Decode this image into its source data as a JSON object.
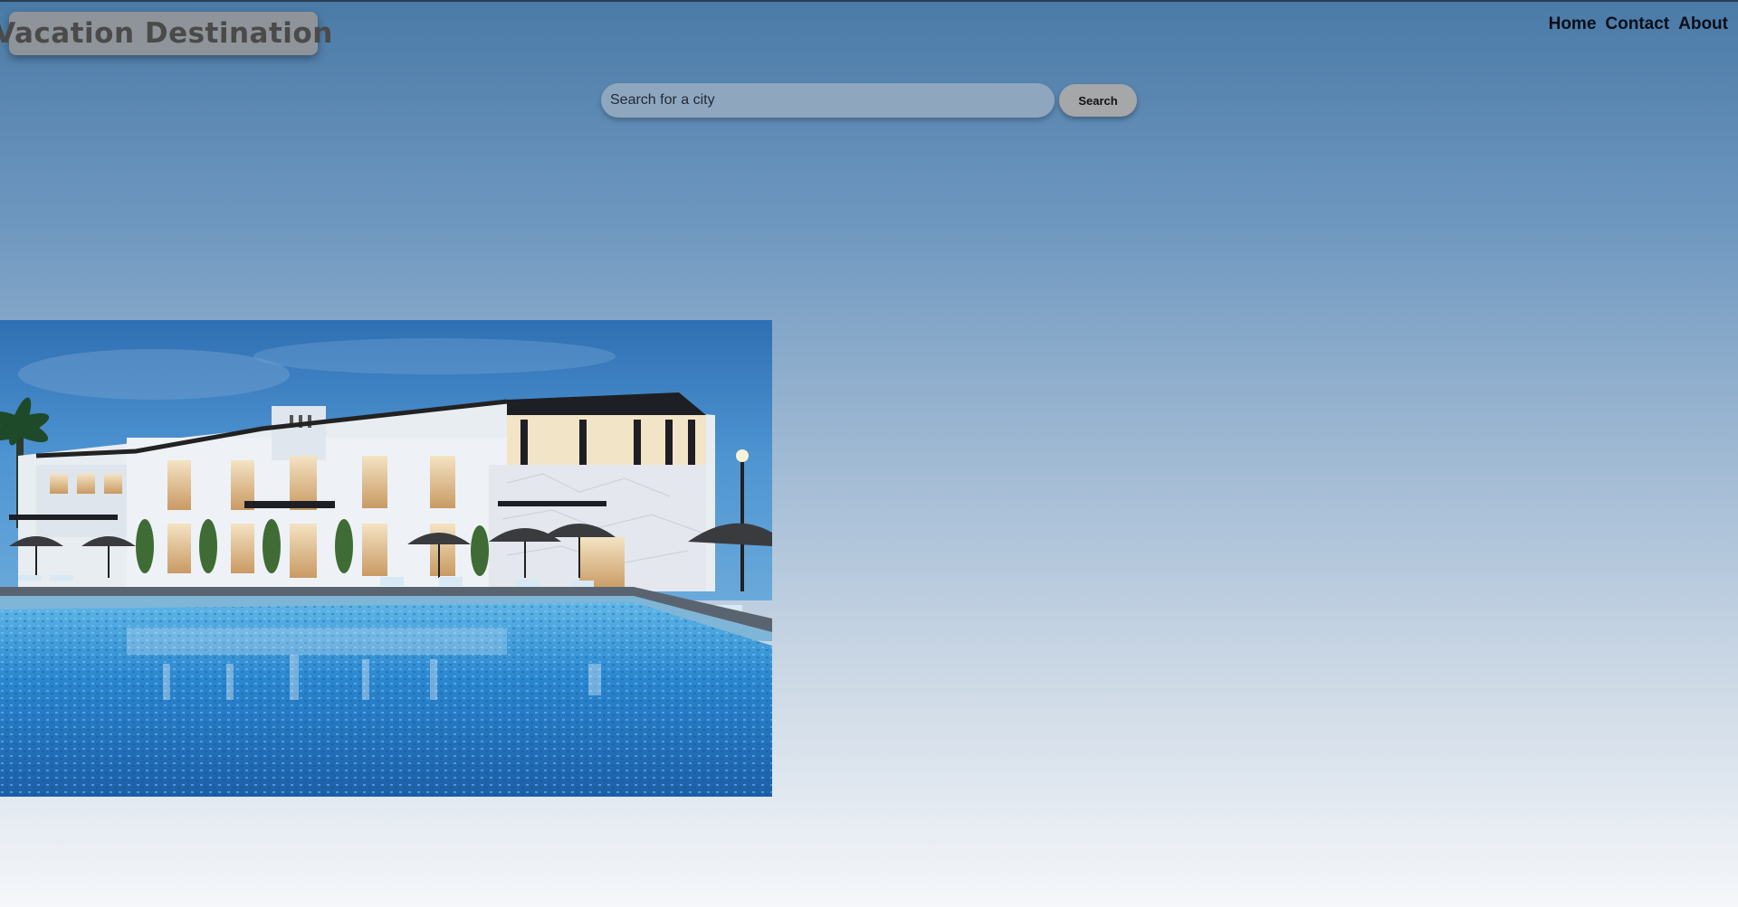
{
  "brand": {
    "title": "Vacation Destination"
  },
  "nav": {
    "items": [
      {
        "label": "Home"
      },
      {
        "label": "Contact"
      },
      {
        "label": "About"
      }
    ]
  },
  "search": {
    "placeholder": "Search for a city",
    "value": "",
    "button_label": "Search"
  },
  "hero": {
    "alt": "Resort building with pool at dusk"
  },
  "colors": {
    "gradient_top": "#4a7aa7",
    "gradient_bottom": "#f5f7fa",
    "brand_bg": "#8f949a",
    "search_bg": "#8fa6bf",
    "button_bg": "#a6a7a9"
  }
}
